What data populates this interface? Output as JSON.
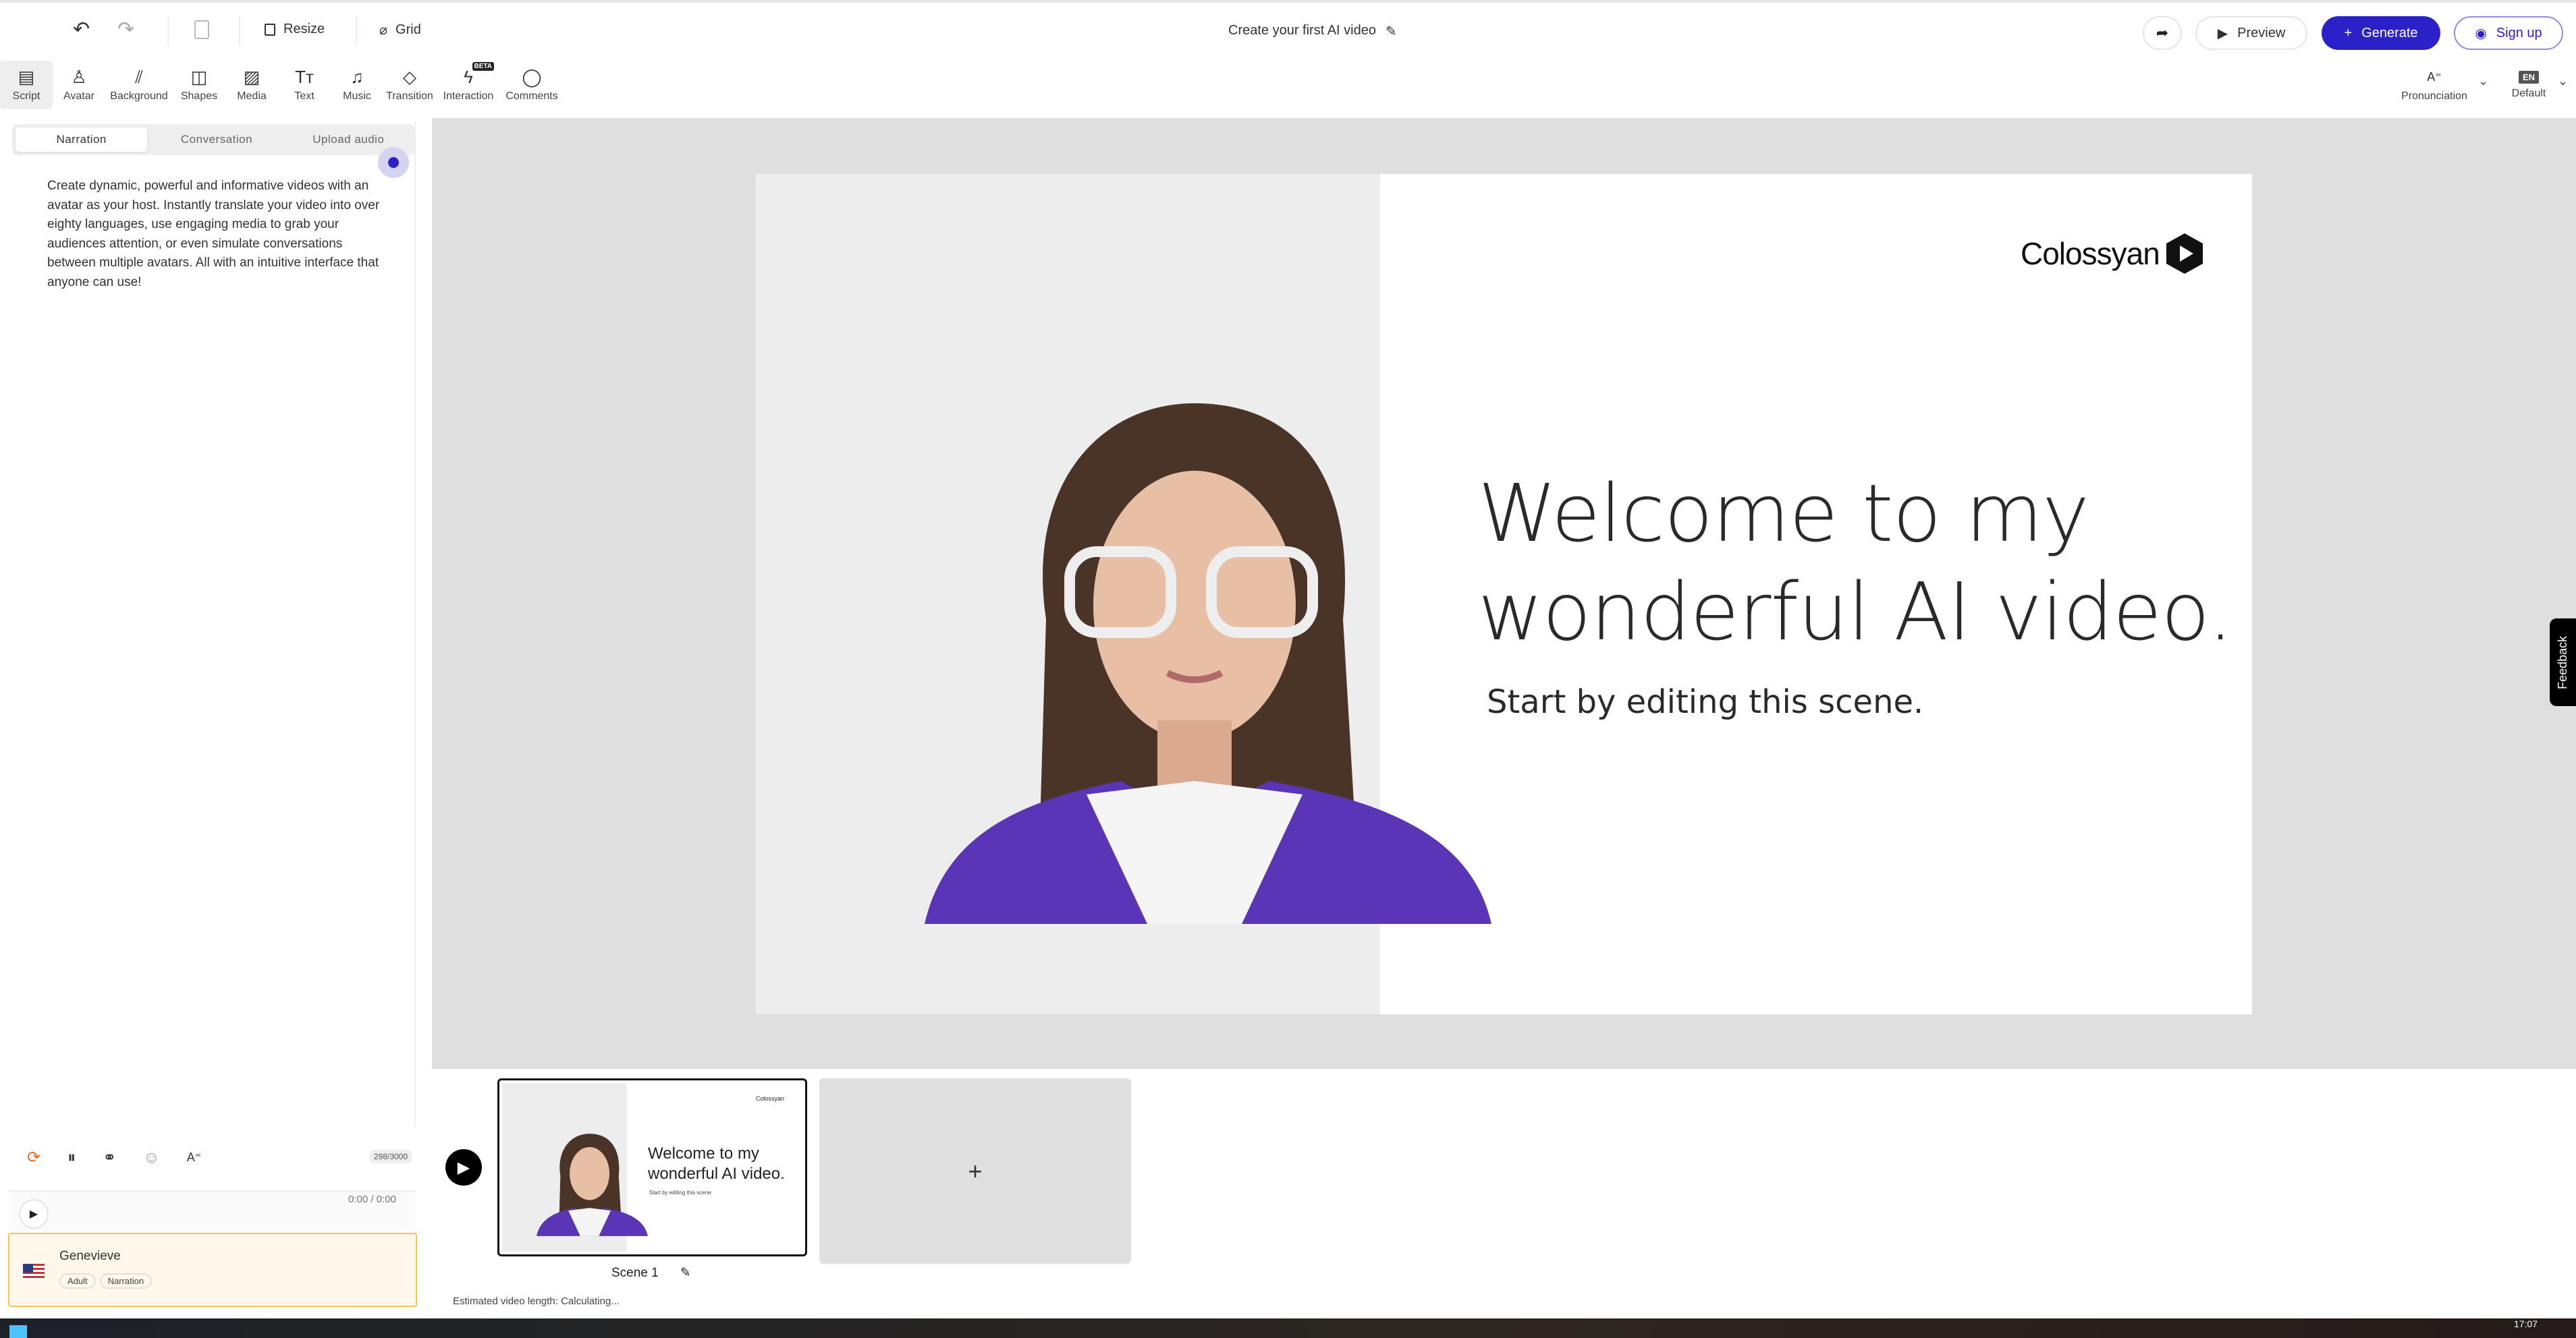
{
  "header": {
    "title": "Create your first AI video",
    "resize": "Resize",
    "grid": "Grid",
    "preview": "Preview",
    "generate": "Generate",
    "signup": "Sign up"
  },
  "tools": [
    {
      "label": "Script",
      "icon": "script-icon"
    },
    {
      "label": "Avatar",
      "icon": "avatar-icon"
    },
    {
      "label": "Background",
      "icon": "background-icon"
    },
    {
      "label": "Shapes",
      "icon": "shapes-icon"
    },
    {
      "label": "Media",
      "icon": "media-icon"
    },
    {
      "label": "Text",
      "icon": "text-icon"
    },
    {
      "label": "Music",
      "icon": "music-icon"
    },
    {
      "label": "Transition",
      "icon": "transition-icon"
    },
    {
      "label": "Interaction",
      "icon": "interaction-icon",
      "badge": "BETA"
    },
    {
      "label": "Comments",
      "icon": "comments-icon"
    }
  ],
  "right_tools": {
    "pronunciation": "Pronunciation",
    "lang_badge": "EN",
    "language": "Default"
  },
  "script_panel": {
    "tabs": [
      "Narration",
      "Conversation",
      "Upload audio"
    ],
    "text": "Create dynamic, powerful and informative videos with an avatar as your host. Instantly translate your video into over eighty languages, use engaging media to grab your audiences attention, or even simulate conversations between multiple avatars. All with an intuitive interface that anyone can use!",
    "char_count": "298/3000",
    "time": "0:00 / 0:00"
  },
  "voice": {
    "name": "Genevieve",
    "tags": [
      "Adult",
      "Narration"
    ]
  },
  "slide": {
    "logo": "Colossyan",
    "heading_1": "Welcome to my",
    "heading_2": "wonderful AI video.",
    "subtitle": "Start by editing this scene."
  },
  "feedback": "Feedback",
  "timeline": {
    "scene_label": "Scene 1",
    "add": "+",
    "estimate": "Estimated video length: Calculating..."
  },
  "taskbar": {
    "time": "17:07"
  },
  "colors": {
    "accent": "#2a22c8",
    "canvas": "#dfdfdf",
    "voice_card": "#fdf7ec"
  }
}
